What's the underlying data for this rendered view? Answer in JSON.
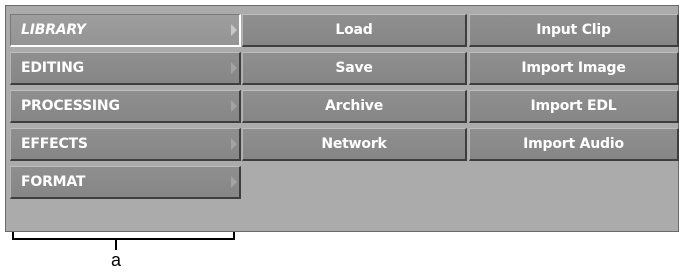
{
  "menu": {
    "items": [
      {
        "label": "LIBRARY",
        "active": true
      },
      {
        "label": "EDITING",
        "active": false
      },
      {
        "label": "PROCESSING",
        "active": false
      },
      {
        "label": "EFFECTS",
        "active": false
      },
      {
        "label": "FORMAT",
        "active": false
      }
    ]
  },
  "actions": {
    "load": "Load",
    "save": "Save",
    "archive": "Archive",
    "network": "Network",
    "input_clip": "Input Clip",
    "import_image": "Import Image",
    "import_edl": "Import EDL",
    "import_audio": "Import Audio"
  },
  "callout": {
    "label": "a"
  },
  "colors": {
    "panel_bg": "#ababab",
    "button_bg": "#8a8a8a",
    "button_text": "#ffffff"
  }
}
